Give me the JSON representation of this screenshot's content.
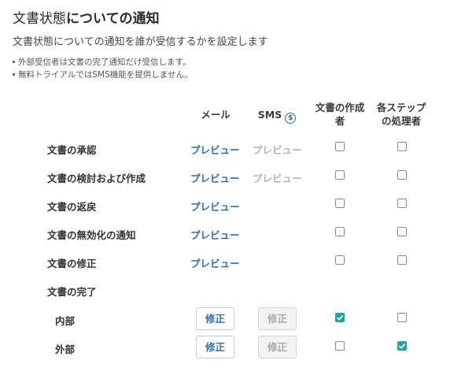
{
  "header": {
    "title_part1": "文書状態",
    "title_part2": "についての通知",
    "description": "文書状態についての通知を誰が受信するかを設定します",
    "notes": [
      "外部受信者は文書の完了通知だけ受信します。",
      "無料トライアルではSMS機能を提供しません。"
    ]
  },
  "columns": {
    "mail": "メール",
    "sms": "SMS",
    "sms_icon": "$",
    "creator_line1": "文書の作成",
    "creator_line2": "者",
    "step_line1": "各ステップ",
    "step_line2": "の処理者"
  },
  "rows": [
    {
      "label": "文書の承認",
      "mail": "プレビュー",
      "sms": "プレビュー",
      "creator_checked": false,
      "step_checked": false
    },
    {
      "label": "文書の検討および作成",
      "mail": "プレビュー",
      "sms": "プレビュー",
      "creator_checked": false,
      "step_checked": false
    },
    {
      "label": "文書の返戻",
      "mail": "プレビュー",
      "creator_checked": false,
      "step_checked": false
    },
    {
      "label": "文書の無効化の通知",
      "mail": "プレビュー",
      "creator_checked": false,
      "step_checked": false
    },
    {
      "label": "文書の修正",
      "mail": "プレビュー",
      "creator_checked": false,
      "step_checked": false
    }
  ],
  "completion": {
    "label": "文書の完了",
    "internal": {
      "label": "内部",
      "mail_button": "修正",
      "sms_button": "修正",
      "creator_checked": true,
      "step_checked": false
    },
    "external": {
      "label": "外部",
      "mail_button": "修正",
      "sms_button": "修正",
      "creator_checked": false,
      "step_checked": true
    }
  },
  "colors": {
    "accent": "#1fa6a0",
    "link": "#2c6fb3"
  }
}
